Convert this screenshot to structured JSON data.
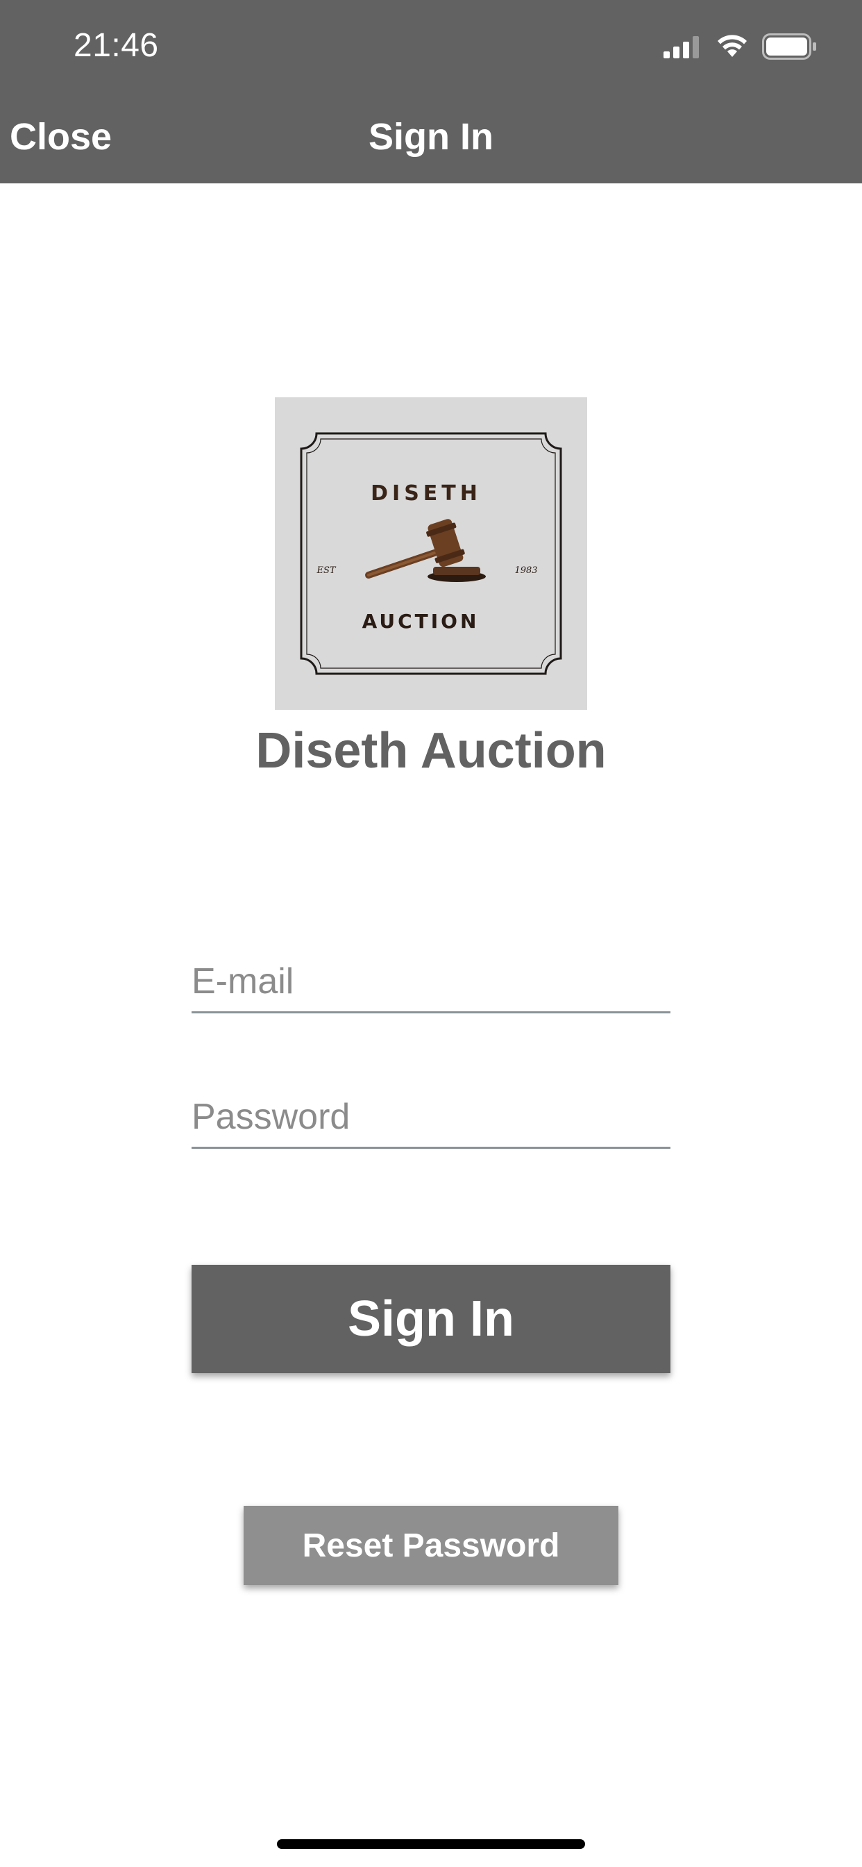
{
  "status_bar": {
    "time": "21:46",
    "icons": [
      "signal-icon",
      "wifi-icon",
      "battery-icon"
    ]
  },
  "nav": {
    "close_label": "Close",
    "title": "Sign In"
  },
  "logo": {
    "top_text": "DISETH",
    "bottom_text": "AUCTION",
    "left_text": "EST",
    "right_text": "1983",
    "icon": "gavel-icon"
  },
  "app_name": "Diseth Auction",
  "form": {
    "email_placeholder": "E-mail",
    "email_value": "",
    "password_placeholder": "Password",
    "password_value": ""
  },
  "buttons": {
    "sign_in_label": "Sign In",
    "reset_password_label": "Reset Password"
  },
  "colors": {
    "header_bg": "#626262",
    "primary_button": "#626262",
    "secondary_button": "#8f8f8f",
    "title_text": "#626262"
  }
}
